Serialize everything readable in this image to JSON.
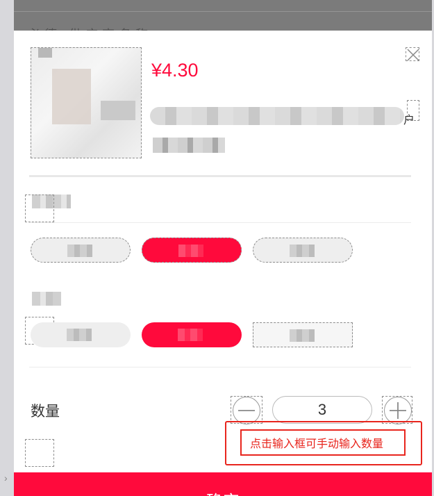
{
  "backdrop": {
    "header_text": "必德 供应商名称"
  },
  "product": {
    "price": "¥4.30",
    "image_alt": "product-image"
  },
  "quantity": {
    "label": "数量",
    "value": "3"
  },
  "annotation": {
    "text": "点击输入框可手动输入数量"
  },
  "footer": {
    "confirm_label": "确定"
  },
  "colors": {
    "accent": "#ff0a3c",
    "annotation": "#e8251d",
    "chip_grey": "#eeeeee"
  },
  "icons": [
    "close-icon",
    "minus-icon",
    "plus-icon",
    "chevron-right-icon"
  ],
  "title_partial_char": "户"
}
